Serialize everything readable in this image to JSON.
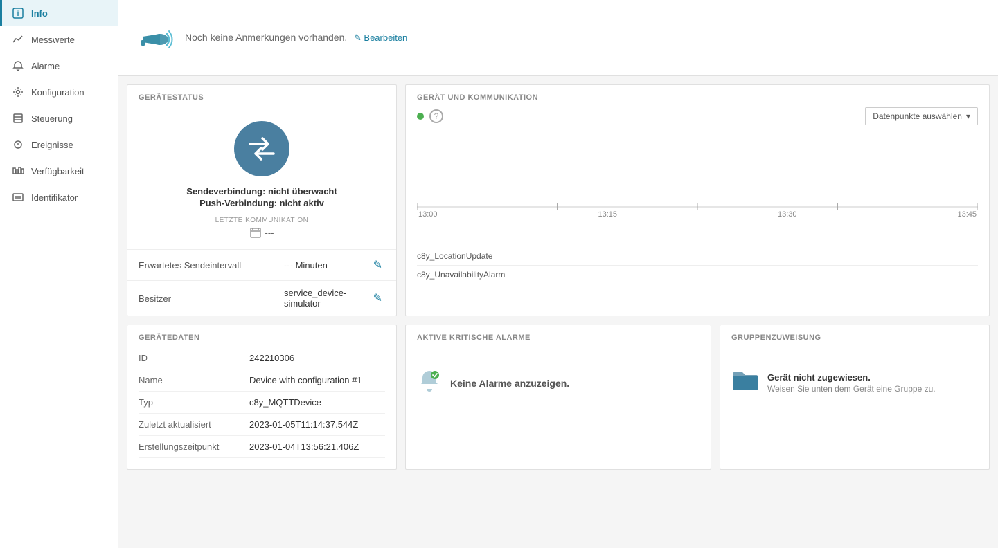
{
  "sidebar": {
    "items": [
      {
        "id": "info",
        "label": "Info",
        "icon": "info",
        "active": true
      },
      {
        "id": "messwerte",
        "label": "Messwerte",
        "icon": "chart-line"
      },
      {
        "id": "alarme",
        "label": "Alarme",
        "icon": "bell"
      },
      {
        "id": "konfiguration",
        "label": "Konfiguration",
        "icon": "settings"
      },
      {
        "id": "steuerung",
        "label": "Steuerung",
        "icon": "control"
      },
      {
        "id": "ereignisse",
        "label": "Ereignisse",
        "icon": "events"
      },
      {
        "id": "verfugbarkeit",
        "label": "Verfügbarkeit",
        "icon": "availability"
      },
      {
        "id": "identifikator",
        "label": "Identifikator",
        "icon": "identifier"
      }
    ]
  },
  "notes": {
    "text": "Noch keine Anmerkungen vorhanden.",
    "edit_label": "✎ Bearbeiten"
  },
  "device_status": {
    "section_title": "GERÄTESTATUS",
    "send_connection": "Sendeverbindung: nicht überwacht",
    "push_connection": "Push-Verbindung: nicht aktiv",
    "letzte_comm_label": "LETZTE KOMMUNIKATION",
    "letzte_comm_value": "---",
    "erwartetes_label": "Erwartetes Sendeintervall",
    "erwartetes_value": "--- Minuten",
    "besitzer_label": "Besitzer",
    "besitzer_value": "service_device-simulator"
  },
  "communication": {
    "section_title": "GERÄT UND KOMMUNIKATION",
    "datenpunkte_btn": "Datenpunkte auswählen",
    "timeline": [
      "13:00",
      "13:15",
      "13:30",
      "13:45"
    ],
    "chart_labels": [
      "c8y_LocationUpdate",
      "c8y_UnavailabilityAlarm"
    ]
  },
  "geraetedaten": {
    "section_title": "GERÄTEDATEN",
    "rows": [
      {
        "key": "ID",
        "value": "242210306"
      },
      {
        "key": "Name",
        "value": "Device with configuration #1"
      },
      {
        "key": "Typ",
        "value": "c8y_MQTTDevice"
      },
      {
        "key": "Zuletzt aktualisiert",
        "value": "2023-01-05T11:14:37.544Z"
      },
      {
        "key": "Erstellungszeitpunkt",
        "value": "2023-01-04T13:56:21.406Z"
      }
    ]
  },
  "alarme": {
    "section_title": "AKTIVE KRITISCHE ALARME",
    "empty_text": "Keine Alarme anzuzeigen."
  },
  "gruppe": {
    "section_title": "GRUPPENZUWEISUNG",
    "main_text": "Gerät nicht zugewiesen.",
    "sub_text": "Weisen Sie unten dem Gerät eine Gruppe zu."
  }
}
